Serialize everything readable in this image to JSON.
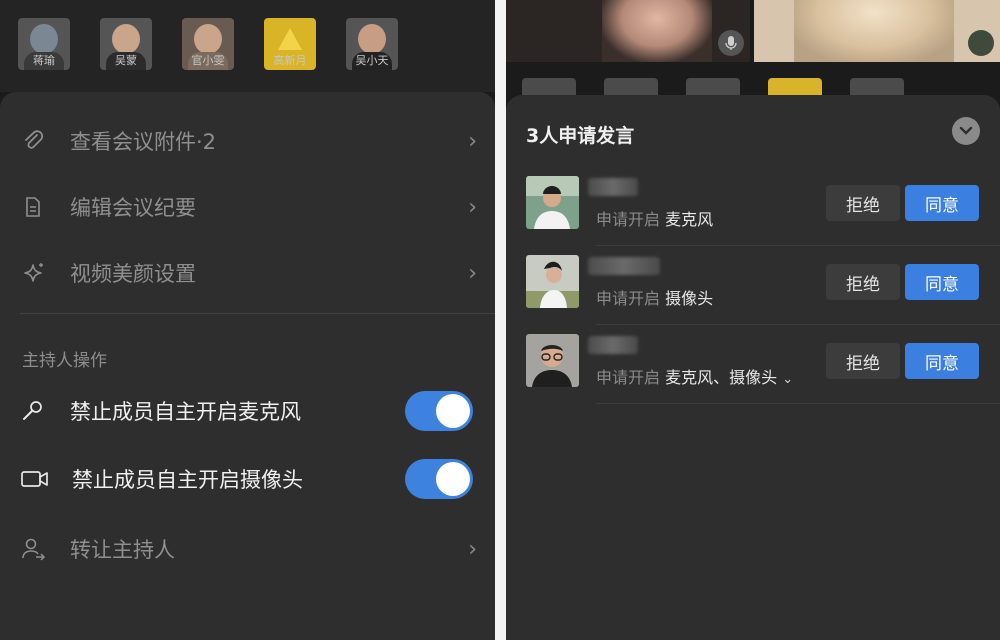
{
  "left": {
    "participants": [
      {
        "name": "蒋瑜"
      },
      {
        "name": "吴蒙"
      },
      {
        "name": "官小雯"
      },
      {
        "name": "高新月"
      },
      {
        "name": "吴小天"
      }
    ],
    "menu": [
      {
        "icon": "paperclip-icon",
        "label": "查看会议附件·2"
      },
      {
        "icon": "document-icon",
        "label": "编辑会议纪要"
      },
      {
        "icon": "sparkle-icon",
        "label": "视频美颜设置"
      }
    ],
    "section_title": "主持人操作",
    "host_actions": [
      {
        "icon": "microphone-icon",
        "label": "禁止成员自主开启麦克风",
        "enabled": true
      },
      {
        "icon": "camera-icon",
        "label": "禁止成员自主开启摄像头",
        "enabled": true
      }
    ],
    "transfer": {
      "icon": "transfer-host-icon",
      "label": "转让主持人"
    }
  },
  "right": {
    "title": "3人申请发言",
    "requests": [
      {
        "prefix": "申请开启",
        "device": "麦克风",
        "reject": "拒绝",
        "agree": "同意"
      },
      {
        "prefix": "申请开启",
        "device": "摄像头",
        "reject": "拒绝",
        "agree": "同意"
      },
      {
        "prefix": "申请开启",
        "device": "麦克风、摄像头",
        "reject": "拒绝",
        "agree": "同意"
      }
    ]
  },
  "colors": {
    "accent": "#3b7fe0",
    "sheet_bg": "#2e2e2e",
    "page_bg": "#1b1b1b"
  }
}
